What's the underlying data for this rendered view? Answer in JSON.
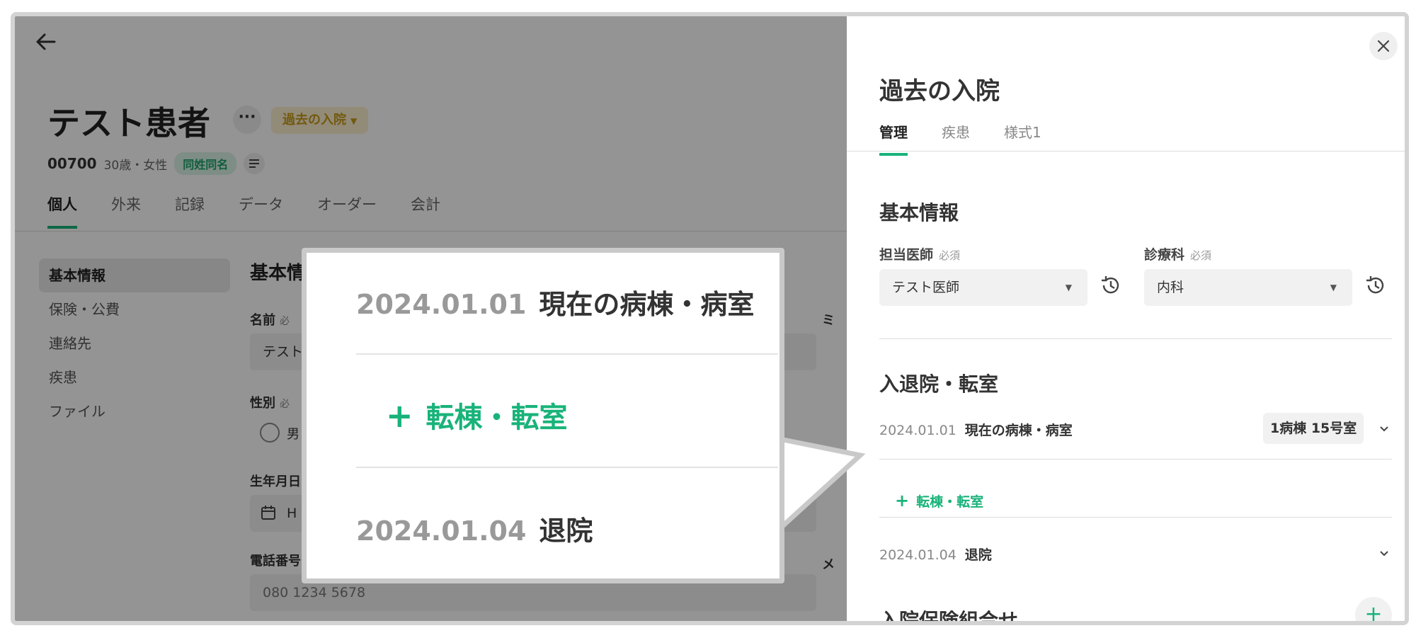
{
  "app": {
    "patient_name": "テスト患者",
    "more_label": "···",
    "past_admission_badge": "過去の入院",
    "patient_id": "00700",
    "age_sex": "30歳・女性",
    "same_name_badge": "同姓同名",
    "tabs": [
      "個人",
      "外来",
      "記録",
      "データ",
      "オーダー",
      "会計"
    ],
    "side_nav": [
      "基本情報",
      "保険・公費",
      "連絡先",
      "疾患",
      "ファイル"
    ],
    "form": {
      "title": "基本情",
      "name_label": "名前",
      "name_req": "必",
      "name_value": "テスト",
      "sex_label": "性別",
      "sex_req": "必",
      "sex_option": "男",
      "birth_label": "生年月日",
      "birth_value": "H",
      "phone_label": "電話番号",
      "phone_value": "080 1234 5678",
      "right_label_1": "ミ",
      "right_label_2": "メ"
    }
  },
  "drawer": {
    "title": "過去の入院",
    "tabs": [
      "管理",
      "疾患",
      "様式1"
    ],
    "basic_info": {
      "heading": "基本情報",
      "doctor_label": "担当医師",
      "doctor_req": "必須",
      "doctor_value": "テスト医師",
      "dept_label": "診療科",
      "dept_req": "必須",
      "dept_value": "内科"
    },
    "admission": {
      "heading": "入退院・転室",
      "row1_date": "2024.01.01",
      "row1_text": "現在の病棟・病室",
      "row1_room": "1病棟 15号室",
      "add_label": "転棟・転室",
      "row2_date": "2024.01.04",
      "row2_text": "退院"
    },
    "insurance_heading": "入院保険組合せ",
    "add_symbol": "+"
  },
  "callout": {
    "row1_date": "2024.01.01",
    "row1_text": "現在の病棟・病室",
    "add_label": "転棟・転室",
    "row2_date": "2024.01.04",
    "row2_text": "退院"
  },
  "colors": {
    "accent_green": "#19b37a",
    "badge_yellow": "#c79a1a",
    "overlay": "rgba(0,0,0,0.42)"
  }
}
